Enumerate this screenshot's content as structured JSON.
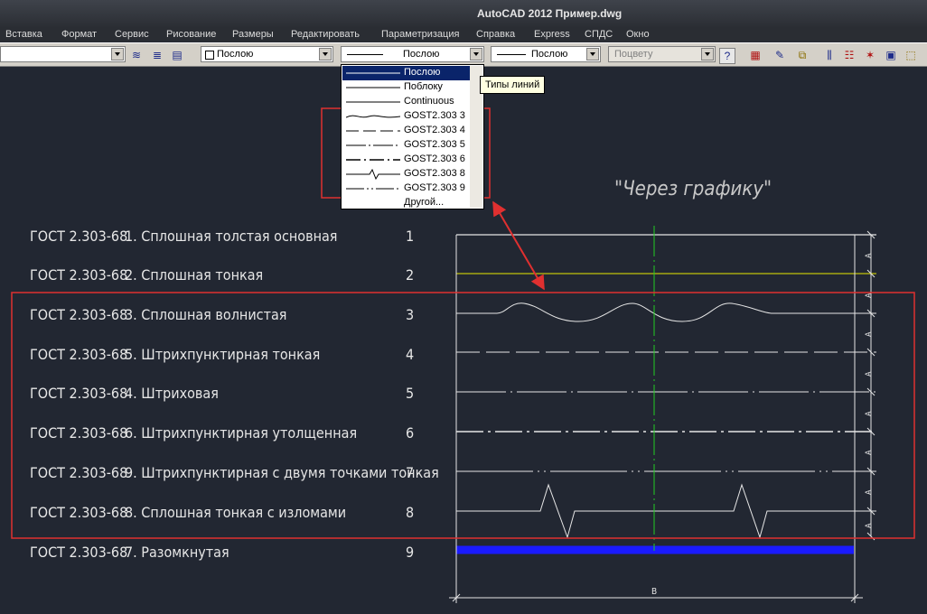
{
  "window": {
    "title": "AutoCAD 2012   Пример.dwg"
  },
  "menu": [
    "Вставка",
    "Формат",
    "Сервис",
    "Рисование",
    "Размеры",
    "Редактировать",
    "Параметризация",
    "Справка",
    "Express",
    "СПДС",
    "Окно"
  ],
  "toolbar": {
    "color_combo": "Послою",
    "linetype_combo": "Послою",
    "lineweight_combo": "Послою",
    "plotstyle_combo": "Поцвету"
  },
  "linetype_dropdown": {
    "items": [
      "Послою",
      "Поблоку",
      "Continuous",
      "GOST2.303 3",
      "GOST2.303 4",
      "GOST2.303 5",
      "GOST2.303 6",
      "GOST2.303 8",
      "GOST2.303 9",
      "Другой..."
    ],
    "selected": "Послою"
  },
  "tooltip": "Типы линий",
  "drawing": {
    "heading": "\"Через графику\"",
    "rows": [
      {
        "prefix": "ГОСТ 2.303-68",
        "name": "1. Сплошная толстая основная",
        "num": "1"
      },
      {
        "prefix": "ГОСТ 2.303-68",
        "name": "2. Сплошная тонкая",
        "num": "2"
      },
      {
        "prefix": "ГОСТ 2.303-68",
        "name": "3. Сплошная волнистая",
        "num": "3"
      },
      {
        "prefix": "ГОСТ 2.303-68",
        "name": "5. Штрихпунктирная тонкая",
        "num": "4"
      },
      {
        "prefix": "ГОСТ 2.303-68",
        "name": "4. Штриховая",
        "num": "5"
      },
      {
        "prefix": "ГОСТ 2.303-68",
        "name": "6. Штрихпунктирная утолщенная",
        "num": "6"
      },
      {
        "prefix": "ГОСТ 2.303-68",
        "name": "9. Штрихпунктирная с двумя точками тонкая",
        "num": "7"
      },
      {
        "prefix": "ГОСТ 2.303-68",
        "name": "8. Сплошная тонкая с изломами",
        "num": "8"
      },
      {
        "prefix": "ГОСТ 2.303-68",
        "name": "7. Разомкнутая",
        "num": "9"
      }
    ],
    "dim_A": "A",
    "dim_B": "B"
  },
  "colors": {
    "background": "#222732",
    "highlight_box": "#e03030",
    "axis": "#22cc22",
    "row2_line": "#e8e800",
    "row9_line": "#1a1aff"
  }
}
